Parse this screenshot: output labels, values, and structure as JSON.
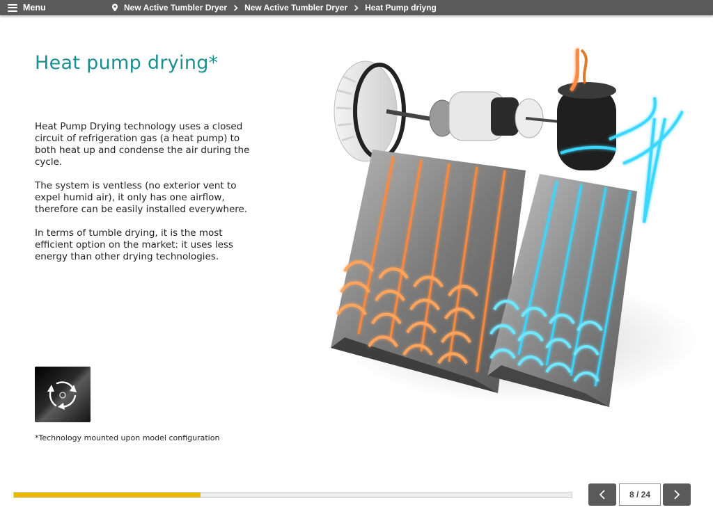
{
  "header": {
    "menu_label": "Menu",
    "breadcrumbs": [
      "New Active Tumbler Dryer",
      "New Active Tumbler Dryer",
      "Heat Pump driyng"
    ]
  },
  "content": {
    "title": "Heat pump drying*",
    "paragraphs": [
      "Heat Pump Drying technology uses a closed circuit of refrigeration gas (a heat pump) to both heat up and condense the air during the cycle.",
      "The system is ventless (no exterior vent to expel humid air), it only has one airflow, therefore can be easily installed everywhere.",
      "In terms of tumble drying, it is the most efficient option on the market: it uses less energy than other drying technologies."
    ],
    "footnote": "*Technology mounted upon model configuration"
  },
  "icons": {
    "menu": "hamburger-icon",
    "location": "location-pin-icon",
    "breadcrumb_separator": "chevron-right-icon",
    "technology": "heat-pump-arrows-icon",
    "prev": "chevron-left-icon",
    "next": "chevron-right-icon"
  },
  "colors": {
    "topbar": "#5a5a5a",
    "title": "#1a8f8f",
    "progress_fill": "#e8b700",
    "hot_coil": "#ff8a3c",
    "cold_coil": "#3ad7ff"
  },
  "footer": {
    "page_indicator": "8 / 24",
    "progress_fraction": 0.335
  }
}
